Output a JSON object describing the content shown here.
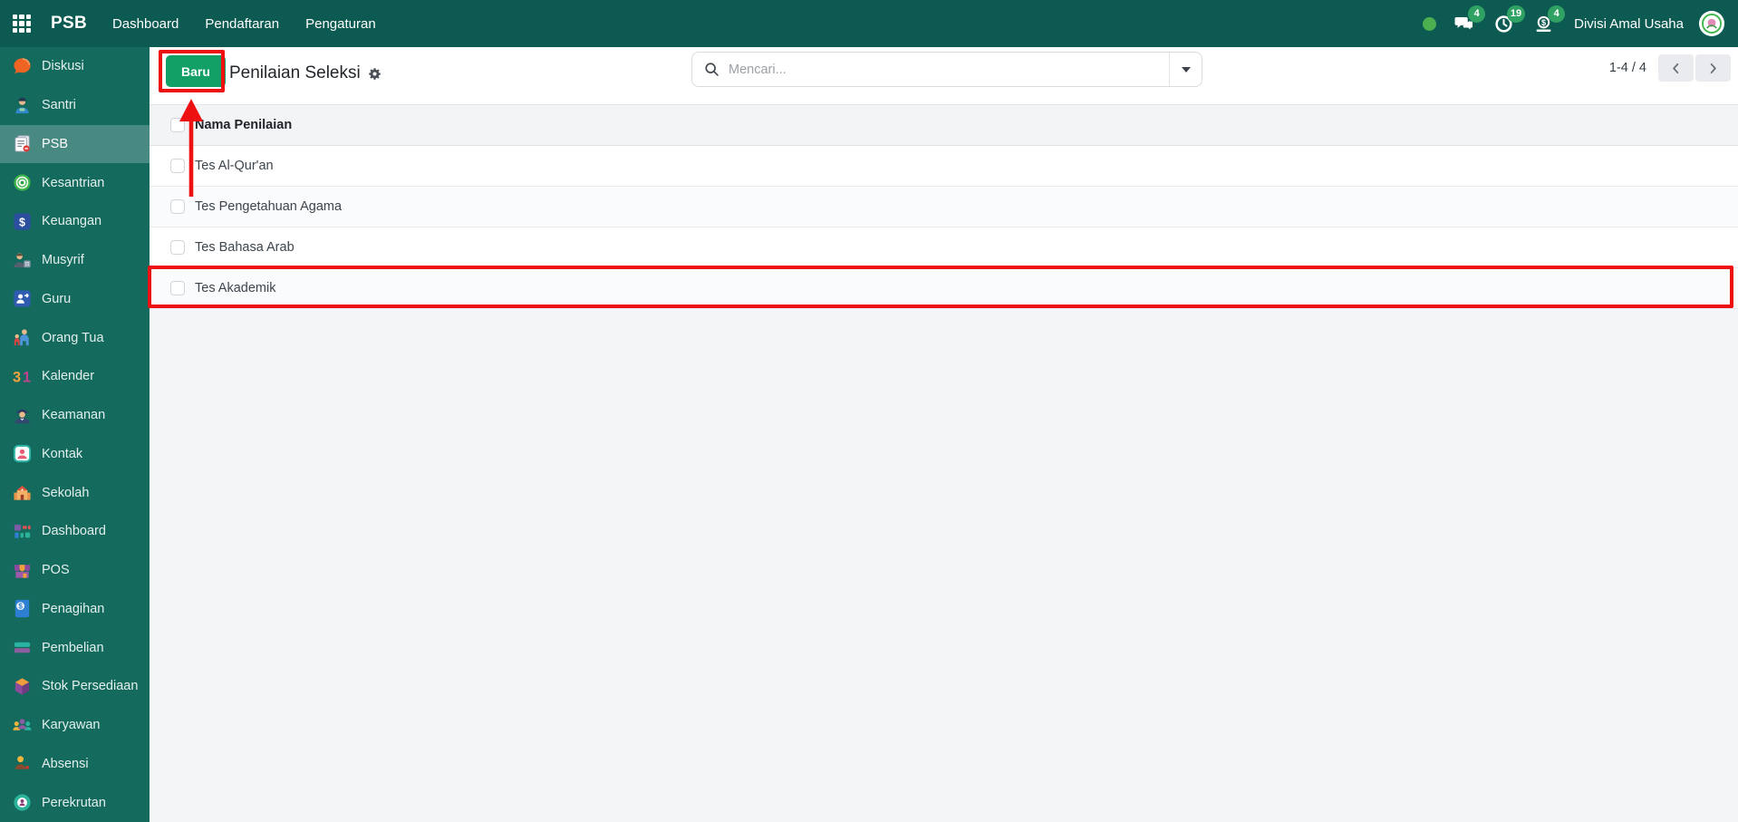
{
  "navbar": {
    "app_name": "PSB",
    "menus": [
      "Dashboard",
      "Pendaftaran",
      "Pengaturan"
    ],
    "systray": {
      "items": [
        {
          "name": "messages",
          "icon": "comments-icon",
          "badge": "4"
        },
        {
          "name": "activities",
          "icon": "clock-icon",
          "badge": "19"
        },
        {
          "name": "revenues",
          "icon": "money-icon",
          "badge": "4"
        }
      ],
      "user_name": "Divisi Amal Usaha"
    }
  },
  "sidebar": {
    "items": [
      {
        "label": "Diskusi",
        "icon": "chat-icon",
        "active": false
      },
      {
        "label": "Santri",
        "icon": "student-icon",
        "active": false
      },
      {
        "label": "PSB",
        "icon": "registration-icon",
        "active": true
      },
      {
        "label": "Kesantrian",
        "icon": "pesantren-logo-icon",
        "active": false
      },
      {
        "label": "Keuangan",
        "icon": "finance-icon",
        "active": false
      },
      {
        "label": "Musyrif",
        "icon": "mentor-icon",
        "active": false
      },
      {
        "label": "Guru",
        "icon": "teacher-icon",
        "active": false
      },
      {
        "label": "Orang Tua",
        "icon": "parents-icon",
        "active": false
      },
      {
        "label": "Kalender",
        "icon": "calendar-icon",
        "active": false
      },
      {
        "label": "Keamanan",
        "icon": "security-icon",
        "active": false
      },
      {
        "label": "Kontak",
        "icon": "contacts-icon",
        "active": false
      },
      {
        "label": "Sekolah",
        "icon": "school-icon",
        "active": false
      },
      {
        "label": "Dashboard",
        "icon": "dashboard-icon",
        "active": false
      },
      {
        "label": "POS",
        "icon": "pos-icon",
        "active": false
      },
      {
        "label": "Penagihan",
        "icon": "billing-icon",
        "active": false
      },
      {
        "label": "Pembelian",
        "icon": "purchase-icon",
        "active": false
      },
      {
        "label": "Stok Persediaan",
        "icon": "inventory-icon",
        "active": false
      },
      {
        "label": "Karyawan",
        "icon": "employees-icon",
        "active": false
      },
      {
        "label": "Absensi",
        "icon": "attendance-icon",
        "active": false
      },
      {
        "label": "Perekrutan",
        "icon": "recruitment-icon",
        "active": false
      }
    ]
  },
  "control_panel": {
    "new_button_label": "Baru",
    "title": "Penilaian Seleksi",
    "search_placeholder": "Mencari...",
    "pager": "1-4 / 4"
  },
  "table": {
    "header": "Nama Penilaian",
    "rows": [
      "Tes Al-Qur'an",
      "Tes Pengetahuan Agama",
      "Tes Bahasa Arab",
      "Tes Akademik"
    ]
  },
  "annotations": {
    "highlighted_button": "Baru",
    "highlighted_row": "Tes Akademik"
  },
  "colors": {
    "navbar_teal": "#0c5a51",
    "sidebar_teal": "#156a5e",
    "button_green": "#12a066",
    "badge_green": "#2fa163",
    "annotation_red": "#ee1111"
  }
}
